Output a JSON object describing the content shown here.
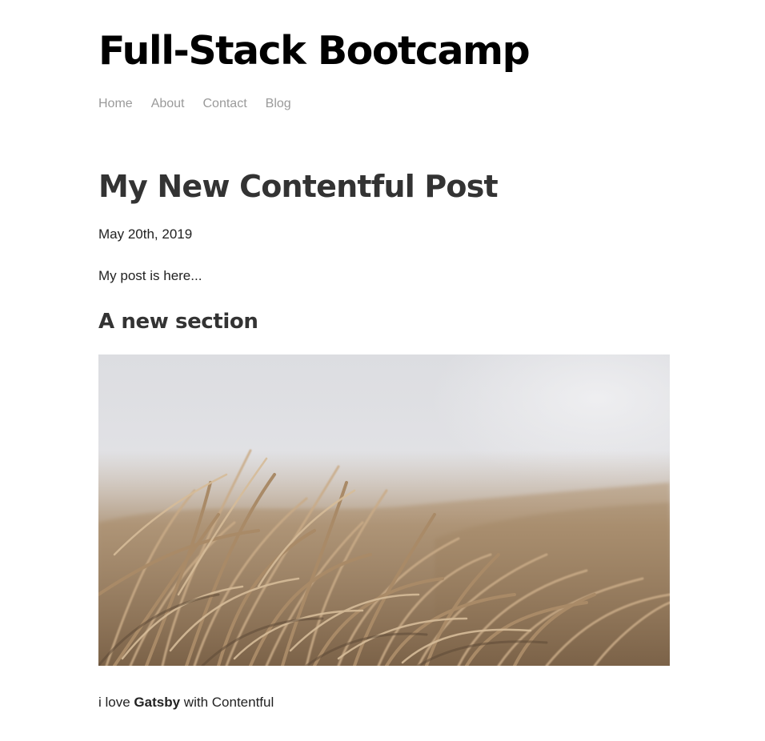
{
  "site": {
    "title": "Full-Stack Bootcamp"
  },
  "nav": {
    "items": [
      {
        "label": "Home"
      },
      {
        "label": "About"
      },
      {
        "label": "Contact"
      },
      {
        "label": "Blog"
      }
    ]
  },
  "post": {
    "title": "My New Contentful Post",
    "date": "May 20th, 2019",
    "intro": "My post is here...",
    "section_heading": "A new section",
    "image": {
      "subject": "dried-grass-photo"
    },
    "footer": {
      "prefix": "i love",
      "emphasis": "Gatsby",
      "suffix": "with Contentful"
    }
  },
  "colors": {
    "nav_link": "#9a9a9a",
    "heading": "#333333",
    "site_title": "#000000",
    "body_text": "#222222"
  }
}
